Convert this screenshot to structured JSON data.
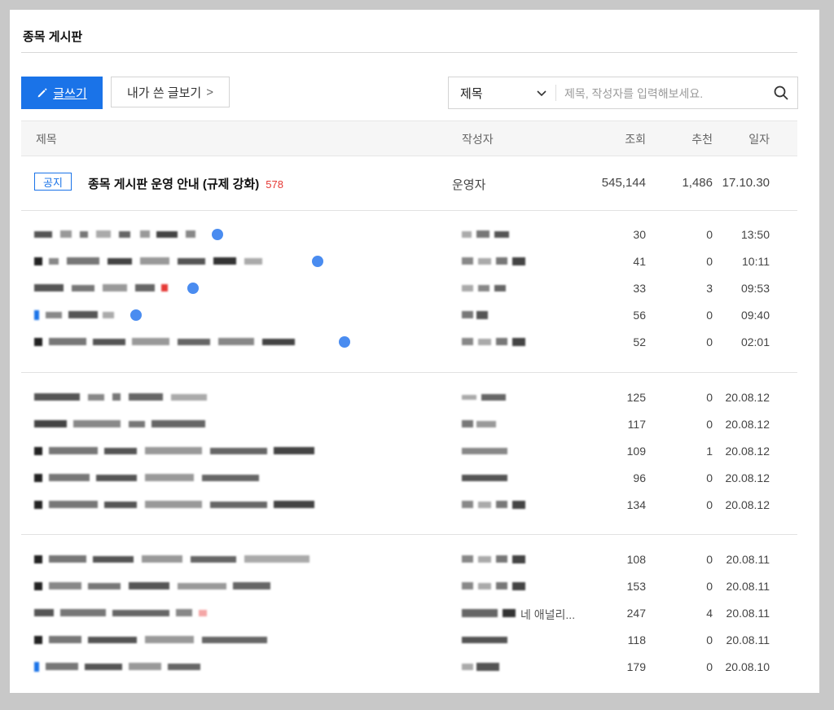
{
  "board": {
    "title": "종목 게시판"
  },
  "toolbar": {
    "write_label": "글쓰기",
    "my_posts_label": "내가 쓴 글보기",
    "my_posts_chevron": ">"
  },
  "search": {
    "selected_option": "제목",
    "placeholder": "제목, 작성자를 입력해보세요."
  },
  "table": {
    "headers": {
      "title": "제목",
      "author": "작성자",
      "views": "조회",
      "recommend": "추천",
      "date": "일자"
    }
  },
  "notice": {
    "badge": "공지",
    "title": "종목 게시판 운영 안내 (규제 강화)",
    "comments": "578",
    "author": "운영자",
    "views": "545,144",
    "recommend": "1,486",
    "date": "17.10.30"
  },
  "groups": [
    {
      "rows": [
        {
          "views": "30",
          "recommend": "0",
          "date": "13:50"
        },
        {
          "views": "41",
          "recommend": "0",
          "date": "10:11"
        },
        {
          "views": "33",
          "recommend": "3",
          "date": "09:53"
        },
        {
          "views": "56",
          "recommend": "0",
          "date": "09:40"
        },
        {
          "views": "52",
          "recommend": "0",
          "date": "02:01"
        }
      ]
    },
    {
      "rows": [
        {
          "views": "125",
          "recommend": "0",
          "date": "20.08.12"
        },
        {
          "views": "117",
          "recommend": "0",
          "date": "20.08.12"
        },
        {
          "views": "109",
          "recommend": "1",
          "date": "20.08.12"
        },
        {
          "views": "96",
          "recommend": "0",
          "date": "20.08.12"
        },
        {
          "views": "134",
          "recommend": "0",
          "date": "20.08.12"
        }
      ]
    },
    {
      "rows": [
        {
          "views": "108",
          "recommend": "0",
          "date": "20.08.11"
        },
        {
          "views": "153",
          "recommend": "0",
          "date": "20.08.11"
        },
        {
          "views": "247",
          "recommend": "4",
          "date": "20.08.11",
          "author_text": "네 애널리..."
        },
        {
          "views": "118",
          "recommend": "0",
          "date": "20.08.11"
        },
        {
          "views": "179",
          "recommend": "0",
          "date": "20.08.10"
        }
      ]
    }
  ],
  "colors": {
    "accent": "#1a73e8",
    "comment_count": "#e53935"
  }
}
